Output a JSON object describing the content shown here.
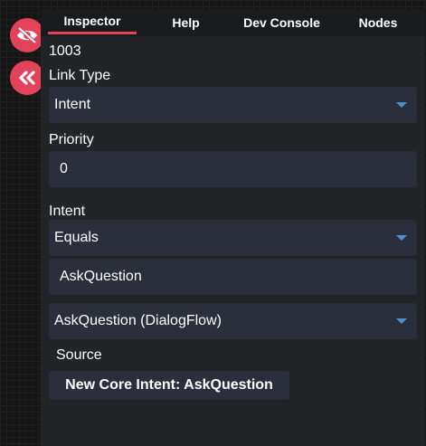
{
  "side_buttons": {
    "hide_icon": "eye-slash-icon",
    "collapse_icon": "double-chevron-left-icon"
  },
  "tabs": [
    {
      "label": "Inspector",
      "active": true
    },
    {
      "label": "Help",
      "active": false
    },
    {
      "label": "Dev Console",
      "active": false
    },
    {
      "label": "Nodes",
      "active": false
    }
  ],
  "inspector": {
    "id": "1003",
    "link_type": {
      "label": "Link Type",
      "value": "Intent"
    },
    "priority": {
      "label": "Priority",
      "value": "0"
    },
    "intent": {
      "label": "Intent",
      "operator": "Equals",
      "name": "AskQuestion",
      "selected_intent": "AskQuestion (DialogFlow)"
    },
    "source": {
      "label": "Source",
      "button_label": "New Core Intent: AskQuestion"
    }
  },
  "colors": {
    "accent": "#e2435a",
    "caret": "#4c8fd4",
    "panel": "#232427",
    "field": "#2b2f3b"
  }
}
